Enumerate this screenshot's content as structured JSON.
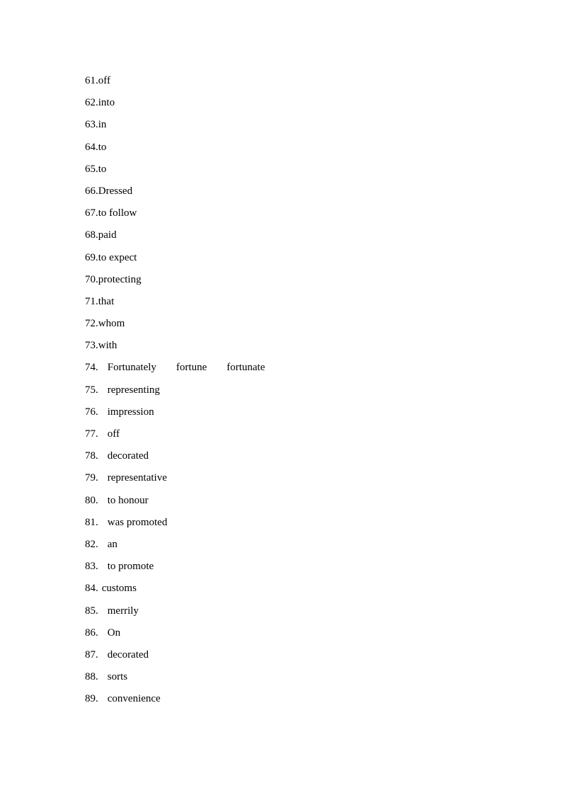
{
  "document": {
    "page_background": "#ffffff",
    "text_color": "#000000",
    "answers": [
      {
        "number": "61.",
        "spacing": "tight",
        "value": "off"
      },
      {
        "number": "62.",
        "spacing": "tight",
        "value": "into"
      },
      {
        "number": "63.",
        "spacing": "tight",
        "value": "in"
      },
      {
        "number": "64.",
        "spacing": "tight",
        "value": "to"
      },
      {
        "number": "65.",
        "spacing": "tight",
        "value": "to"
      },
      {
        "number": "66.",
        "spacing": "tight",
        "value": "Dressed"
      },
      {
        "number": "67.",
        "spacing": "tight",
        "value": "to follow"
      },
      {
        "number": "68.",
        "spacing": "tight",
        "value": "paid"
      },
      {
        "number": "69.",
        "spacing": "tight",
        "value": "to expect"
      },
      {
        "number": "70.",
        "spacing": "tight",
        "value": "protecting"
      },
      {
        "number": "71.",
        "spacing": "tight",
        "value": "that"
      },
      {
        "number": "72.",
        "spacing": "tight",
        "value": "whom"
      },
      {
        "number": "73.",
        "spacing": "tight",
        "value": "with"
      },
      {
        "number": "74.",
        "spacing": "loose",
        "value": "Fortunately",
        "alternatives": [
          "fortune",
          "fortunate"
        ]
      },
      {
        "number": "75.",
        "spacing": "loose",
        "value": "representing"
      },
      {
        "number": "76.",
        "spacing": "loose",
        "value": "impression"
      },
      {
        "number": "77.",
        "spacing": "loose",
        "value": "off"
      },
      {
        "number": "78.",
        "spacing": "loose",
        "value": "decorated"
      },
      {
        "number": "79.",
        "spacing": "loose",
        "value": "representative"
      },
      {
        "number": "80.",
        "spacing": "loose",
        "value": "to honour"
      },
      {
        "number": "81.",
        "spacing": "loose",
        "value": "was promoted"
      },
      {
        "number": "82.",
        "spacing": "loose",
        "value": "an"
      },
      {
        "number": "83.",
        "spacing": "loose",
        "value": "to promote"
      },
      {
        "number": "84.",
        "spacing": "narrow",
        "value": "customs"
      },
      {
        "number": "85.",
        "spacing": "loose",
        "value": "merrily"
      },
      {
        "number": "86.",
        "spacing": "loose",
        "value": "On"
      },
      {
        "number": "87.",
        "spacing": "loose",
        "value": "decorated"
      },
      {
        "number": "88.",
        "spacing": "loose",
        "value": "sorts"
      },
      {
        "number": "89.",
        "spacing": "loose",
        "value": "convenience"
      }
    ]
  }
}
